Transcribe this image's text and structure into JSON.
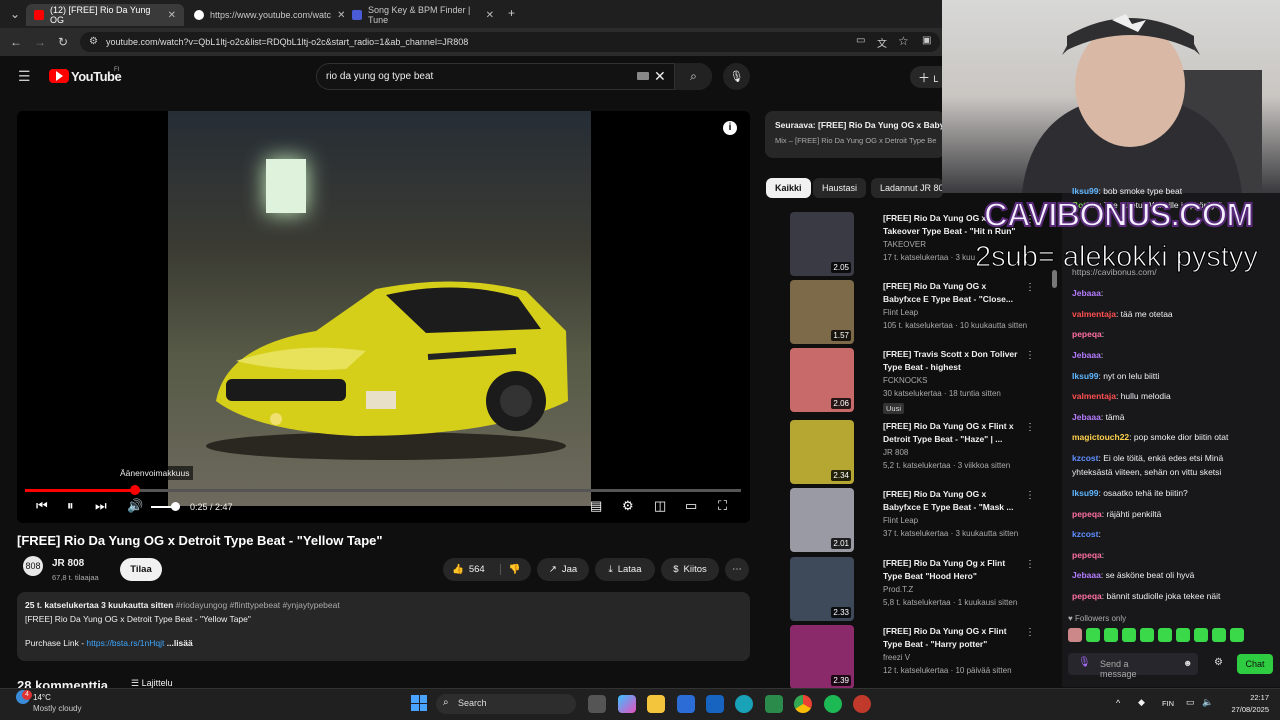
{
  "browser": {
    "tabs": [
      {
        "label": "(12) [FREE] Rio Da Yung OG",
        "color": "#ff0000"
      },
      {
        "label": "https://www.youtube.com/watc",
        "color": "#ffffff"
      },
      {
        "label": "Song Key & BPM Finder | Tune",
        "color": "#4a5bd8"
      }
    ],
    "url": "youtube.com/watch?v=QbL1ltj-o2c&list=RDQbL1ltj-o2c&start_radio=1&ab_channel=JR808"
  },
  "youtube": {
    "logo": "YouTube",
    "country": "FI",
    "search_query": "rio da yung og type beat",
    "create_label": "L",
    "player": {
      "tooltip": "Äänenvoimakkuus",
      "time": "0:25 / 2:47",
      "progress_fraction": 0.153
    },
    "video_title": "[FREE] Rio Da Yung OG x Detroit Type Beat - \"Yellow Tape\"",
    "channel": {
      "name": "JR 808",
      "subs": "67,8 t. tilaajaa",
      "subscribe": "Tilaa",
      "avatar": "808"
    },
    "actions": {
      "likes": "564",
      "share": "Jaa",
      "download": "Lataa",
      "thanks": "Kiitos",
      "more": "⋯"
    },
    "description": {
      "stats": "25 t. katselukertaa  3 kuukautta sitten",
      "tags": "#riodayungog #flinttypebeat #ynjaytypebeat",
      "line1": "[FREE] Rio Da Yung OG x Detroit Type Beat - \"Yellow Tape\"",
      "link_label": "Purchase Link - ",
      "link": "https://bsta.rs/1nHqjt",
      "more": "...lisää"
    },
    "comments": "28 kommenttia",
    "sort": "Lajittelu",
    "up_next": {
      "title": "Seuraava: [FREE] Rio Da Yung OG x Baby",
      "subtitle": "Mix – [FREE] Rio Da Yung OG x Detroit Type Be"
    },
    "chips": [
      "Kaikki",
      "Haustasi",
      "Ladannut JR 808"
    ],
    "recommendations": [
      {
        "title": "[FREE] Rio Da Yung OG x Takeover Type Beat - \"Hit n Run\"",
        "channel": "TAKEOVER",
        "meta": "17 t. katselukertaa · 3 kuu",
        "duration": "2.05",
        "thumb": "#3a3a44"
      },
      {
        "title": "[FREE] Rio Da Yung OG x Babyfxce E Type Beat - \"Close...",
        "channel": "Flint Leap",
        "meta": "105 t. katselukertaa · 10 kuukautta sitten",
        "duration": "1.57",
        "thumb": "#7c6a48"
      },
      {
        "title": "[FREE] Travis Scott x Don Toliver Type Beat - highest",
        "channel": "FCKNOCKS",
        "meta": "30 katselukertaa · 18 tuntia sitten",
        "duration": "2.06",
        "thumb": "#c96a6a",
        "badge": "Uusi"
      },
      {
        "title": "[FREE] Rio Da Yung OG x Flint x Detroit Type Beat - \"Haze\" | ...",
        "channel": "JR 808",
        "meta": "5,2 t. katselukertaa · 3 viikkoa sitten",
        "duration": "2.34",
        "thumb": "#b6a632"
      },
      {
        "title": "[FREE] Rio Da Yung OG x Babyfxce E Type Beat - \"Mask ...",
        "channel": "Flint Leap",
        "meta": "37 t. katselukertaa · 3 kuukautta sitten",
        "duration": "2.01",
        "thumb": "#9a9aa4"
      },
      {
        "title": "[FREE] Rio Da Yung Og x Flint Type Beat \"Hood Hero\"",
        "channel": "Prod.T.Z",
        "meta": "5,8 t. katselukertaa · 1 kuukausi sitten",
        "duration": "2.33",
        "thumb": "#3e4a5a"
      },
      {
        "title": "[FREE] Rio Da Yung OG x Flint Type Beat - \"Harry potter\"",
        "channel": "freezi V",
        "meta": "12 t. katselukertaa · 10 päivää sitten",
        "duration": "2.39",
        "thumb": "#8a2a6a"
      }
    ]
  },
  "stream": {
    "overlay_brand": "CAVIBONUS.COM",
    "overlay_sub": "2sub= alekokki pystyy",
    "chat": [
      {
        "user": "Iksu99",
        "color": "#5fb6ff",
        "text": ": bob smoke type beat"
      },
      {
        "user": "BotRix",
        "color": "#7fd65a",
        "text": ": Tee talletus Winzille ja pyöräytä"
      },
      {
        "user": "",
        "color": "#aaa",
        "text": "https://cavibonus.com/"
      },
      {
        "user": "Jebaaa",
        "color": "#b67cff",
        "text": ": "
      },
      {
        "user": "valmentaja",
        "color": "#ff4f4f",
        "text": ": tää me otetaa"
      },
      {
        "user": "pepeqa",
        "color": "#ff6f9f",
        "text": ": "
      },
      {
        "user": "Jebaaa",
        "color": "#b67cff",
        "text": ": "
      },
      {
        "user": "Iksu99",
        "color": "#5fb6ff",
        "text": ": nyt on lelu biitti"
      },
      {
        "user": "valmentaja",
        "color": "#ff4f4f",
        "text": ": hullu melodia"
      },
      {
        "user": "Jebaaa",
        "color": "#b67cff",
        "text": ": tämä"
      },
      {
        "user": "magictouch22",
        "color": "#ffd24a",
        "text": ": pop smoke dior biitin otat"
      },
      {
        "user": "kzcost",
        "color": "#5f8fff",
        "text": ": Ei ole töitä, enkä edes etsi Minä"
      },
      {
        "user": "",
        "color": "#efeff1",
        "text": "yhteksästä viiteen, sehän on vittu sketsi"
      },
      {
        "user": "Iksu99",
        "color": "#5fb6ff",
        "text": ": osaatko tehä ite biitin?"
      },
      {
        "user": "pepeqa",
        "color": "#ff6f9f",
        "text": ": räjähti penkiltä"
      },
      {
        "user": "kzcost",
        "color": "#5f8fff",
        "text": ": "
      },
      {
        "user": "pepeqa",
        "color": "#ff6f9f",
        "text": ": "
      },
      {
        "user": "Jebaaa",
        "color": "#b67cff",
        "text": ": se äsköne beat oli hyvä"
      },
      {
        "user": "pepeqa",
        "color": "#ff6f9f",
        "text": ": bännit studiolle joka tekee näit"
      }
    ],
    "followers": "Followers only",
    "input_placeholder": "Send a message",
    "chat_button": "Chat"
  },
  "taskbar": {
    "weather_temp": "14°C",
    "weather_desc": "Mostly cloudy",
    "weather_badge": "4",
    "search": "Search",
    "lang": "FIN",
    "time": "22:17",
    "date": "27/08/2025"
  }
}
